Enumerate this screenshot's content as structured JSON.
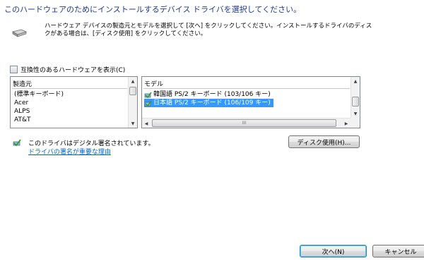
{
  "heading": "このハードウェアのためにインストールするデバイス ドライバを選択してください。",
  "instruction": "ハードウェア デバイスの製造元とモデルを選択して [次へ] をクリックしてください。インストールするドライバのディスクがある場合は、[ディスク使用] をクリックしてください。",
  "compat_checkbox": {
    "label": "互換性のあるハードウェアを表示(C)",
    "checked": false
  },
  "manufacturer": {
    "header": "製造元",
    "items": [
      "(標準キーボード)",
      "Acer",
      "ALPS",
      "AT&T"
    ]
  },
  "model": {
    "header": "モデル",
    "items": [
      {
        "label": "韓国語 PS/2 キーボード (103/106 キー)",
        "selected": false
      },
      {
        "label": "日本語 PS/2 キーボード (106/109 キー)",
        "selected": true
      }
    ],
    "hscroll_glyph": "III"
  },
  "signature": {
    "text": "このドライバはデジタル署名されています。",
    "link": "ドライバの署名が重要な理由"
  },
  "buttons": {
    "disk": "ディスク使用(H)...",
    "next": "次へ(N)",
    "cancel": "キャンセル"
  },
  "colors": {
    "heading": "#1e3a8a",
    "selection": "#3399ff",
    "link": "#0066cc"
  },
  "icons": {
    "device": "keyboard-device-icon",
    "driver": "signed-driver-icon",
    "scroll_up": "up-arrow-icon",
    "scroll_down": "down-arrow-icon",
    "scroll_left": "left-arrow-icon",
    "scroll_right": "right-arrow-icon"
  }
}
